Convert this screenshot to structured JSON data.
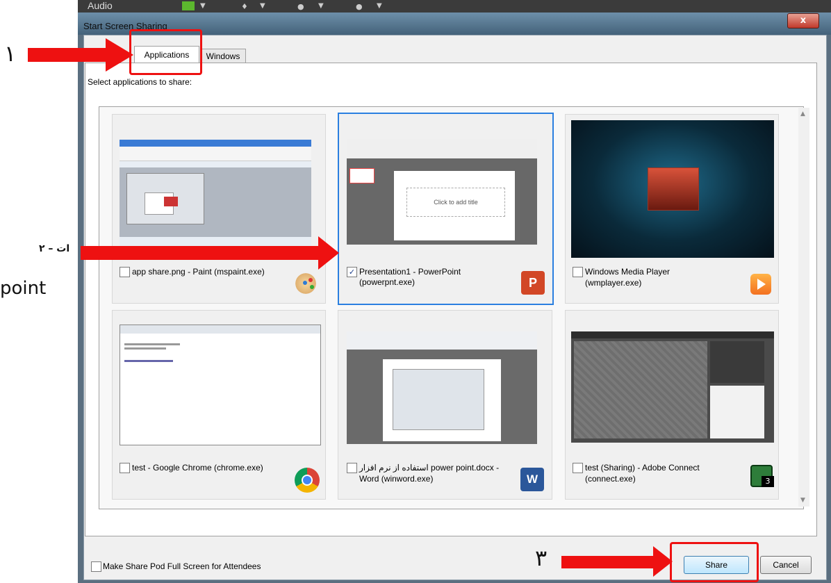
{
  "taskbar": {
    "audio_label": "Audio"
  },
  "dialog": {
    "title": "Start Screen Sharing",
    "close_label": "x",
    "tabs": [
      {
        "label": "Applications"
      },
      {
        "label": "Windows"
      }
    ],
    "instruction": "Select applications to share:",
    "apps": [
      {
        "line1": "app share.png - Paint (mspaint.exe)",
        "line2": "",
        "checked": false,
        "icon": "paint-icon"
      },
      {
        "line1": "Presentation1 - PowerPoint",
        "line2": "(powerpnt.exe)",
        "checked": true,
        "icon": "powerpoint-icon",
        "thumb_text": "Click to add title"
      },
      {
        "line1": "Windows Media Player",
        "line2": "(wmplayer.exe)",
        "checked": false,
        "icon": "media-player-icon"
      },
      {
        "line1": "test - Google Chrome (chrome.exe)",
        "line2": "",
        "checked": false,
        "icon": "chrome-icon"
      },
      {
        "line1": "استفاده از نرم افزار power point.docx -",
        "line2": "Word (winword.exe)",
        "checked": false,
        "icon": "word-icon"
      },
      {
        "line1": "test (Sharing) - Adobe Connect",
        "line2": "(connect.exe)",
        "checked": false,
        "icon": "adobe-connect-icon",
        "badge": "3"
      }
    ],
    "fullscreen_label": "Make Share Pod Full Screen for Attendees",
    "share_label": "Share",
    "cancel_label": "Cancel"
  },
  "annotations": {
    "step1": "۱",
    "step2": "۲ – ات",
    "step2_sub": "point",
    "step3": "۳",
    "color": "#ee1111"
  }
}
